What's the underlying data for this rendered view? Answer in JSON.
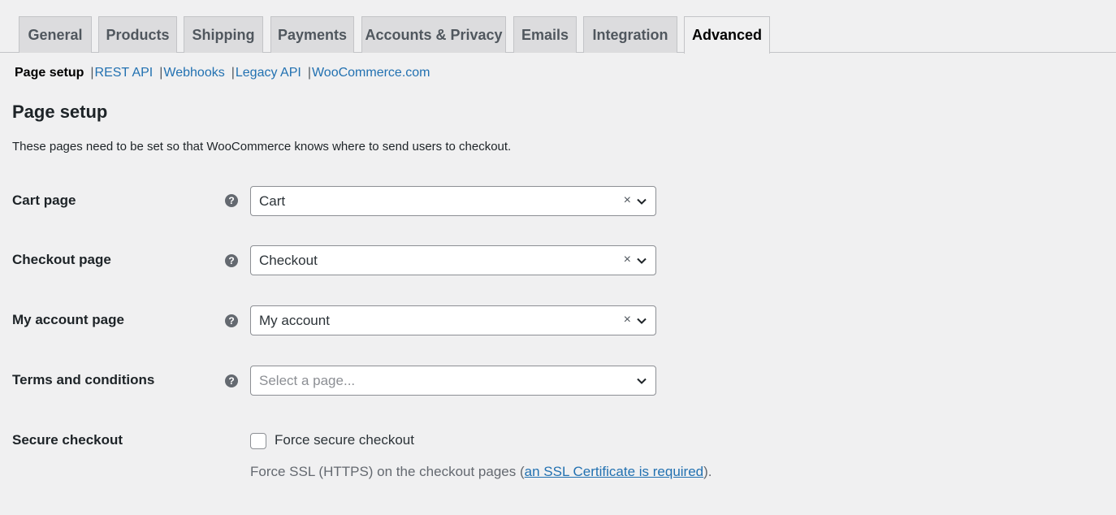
{
  "tabs": [
    {
      "label": "General"
    },
    {
      "label": "Products"
    },
    {
      "label": "Shipping"
    },
    {
      "label": "Payments"
    },
    {
      "label": "Accounts & Privacy"
    },
    {
      "label": "Emails"
    },
    {
      "label": "Integration"
    },
    {
      "label": "Advanced",
      "active": true
    }
  ],
  "subnav": {
    "current": "Page setup",
    "links": [
      "REST API",
      "Webhooks",
      "Legacy API",
      "WooCommerce.com"
    ],
    "separator": "|"
  },
  "section": {
    "title": "Page setup",
    "description": "These pages need to be set so that WooCommerce knows where to send users to checkout."
  },
  "fields": {
    "cart": {
      "label": "Cart page",
      "value": "Cart"
    },
    "checkout": {
      "label": "Checkout page",
      "value": "Checkout"
    },
    "myaccount": {
      "label": "My account page",
      "value": "My account"
    },
    "terms": {
      "label": "Terms and conditions",
      "placeholder": "Select a page..."
    },
    "secure": {
      "label": "Secure checkout",
      "checkbox_label": "Force secure checkout",
      "checked": false,
      "note_before": "Force SSL (HTTPS) on the checkout pages (",
      "note_link": "an SSL Certificate is required",
      "note_after": ")."
    }
  },
  "icons": {
    "help": "help-icon",
    "clear": "clear-icon",
    "chevron": "chevron-down-icon"
  },
  "glyphs": {
    "help": "?",
    "clear": "×"
  }
}
